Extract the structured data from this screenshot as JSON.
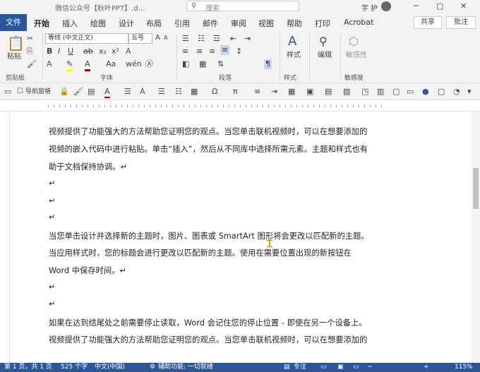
{
  "titlebar": {
    "title": "微信公众号【秋叶PPT】.d...",
    "search_placeholder": "搜索",
    "user": "宇 护",
    "min": "─",
    "restore": "▢",
    "close": "✕"
  },
  "tabs": [
    "文件",
    "开始",
    "插入",
    "绘图",
    "设计",
    "布局",
    "引用",
    "邮件",
    "审阅",
    "视图",
    "帮助",
    "打印",
    "Acrobat"
  ],
  "tab_active": "开始",
  "share": "共享",
  "annotate": "批注",
  "ribbon": {
    "clipboard": {
      "label": "剪贴板",
      "paste": "粘贴"
    },
    "font": {
      "label": "字体",
      "font_name": "等线 (中文正文)",
      "font_size": "五号",
      "wen": "wén",
      "A_big": "A",
      "A_small": "A"
    },
    "paragraph": {
      "label": "段落"
    },
    "styles": {
      "label": "样式",
      "btn": "样式"
    },
    "editing": {
      "btn": "编辑"
    },
    "sensitivity": {
      "label": "敏感度",
      "btn": "敏感性"
    }
  },
  "qat": {
    "nav_pane": "导航窗格"
  },
  "document": {
    "lines": [
      "视频提供了功能强大的方法帮助您证明您的观点。当您单击联机视频时，可以在想要添加的",
      "视频的嵌入代码中进行粘贴。单击“插入”，然后从不同库中选择所需元素。主题和样式也有",
      "助于文档保持协调。↵",
      "↵",
      "↵",
      "↵",
      "当您单击设计并选择新的主题时，图片、图表或 SmartArt 图形将会更改以匹配新的主题。",
      "当应用样式时，您的标题会进行更改以匹配新的主题。使用在需要位置出现的新按钮在",
      "Word 中保存时间。↵",
      "↵",
      "↵",
      "如果在达到结尾处之前需要停止读取，Word 会记住您的停止位置 - 即使在另一个设备上。",
      "视频提供了功能强大的方法帮助您证明您的观点。当您单击联机视频时，可以在想要添加的"
    ]
  },
  "status": {
    "page": "第 1 页，共 1 页",
    "words": "525 个字",
    "lang": "中文(中国)",
    "access": "辅助功能: 一切就绪",
    "focus": "专注",
    "zoom": "115%"
  },
  "colors": {
    "accent": "#2b579a",
    "highlight": "#ffff00",
    "font_red": "#c00000",
    "cursor": "#c8a400"
  }
}
